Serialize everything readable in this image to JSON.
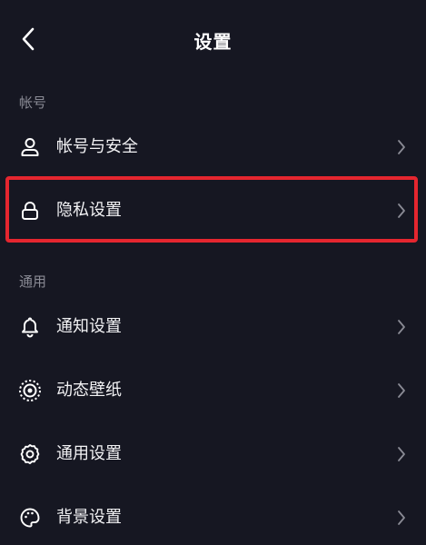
{
  "header": {
    "title": "设置",
    "back_icon": "chevron-left-icon"
  },
  "sections": [
    {
      "title": "帐号",
      "items": [
        {
          "label": "帐号与安全",
          "icon": "user-icon"
        },
        {
          "label": "隐私设置",
          "icon": "lock-icon",
          "highlighted": true
        }
      ]
    },
    {
      "title": "通用",
      "items": [
        {
          "label": "通知设置",
          "icon": "bell-icon"
        },
        {
          "label": "动态壁纸",
          "icon": "live-wallpaper-icon"
        },
        {
          "label": "通用设置",
          "icon": "gear-icon"
        },
        {
          "label": "背景设置",
          "icon": "palette-icon"
        }
      ]
    }
  ],
  "colors": {
    "background": "#161722",
    "highlight_border": "#e5262f",
    "section_label": "#8a8b95"
  }
}
